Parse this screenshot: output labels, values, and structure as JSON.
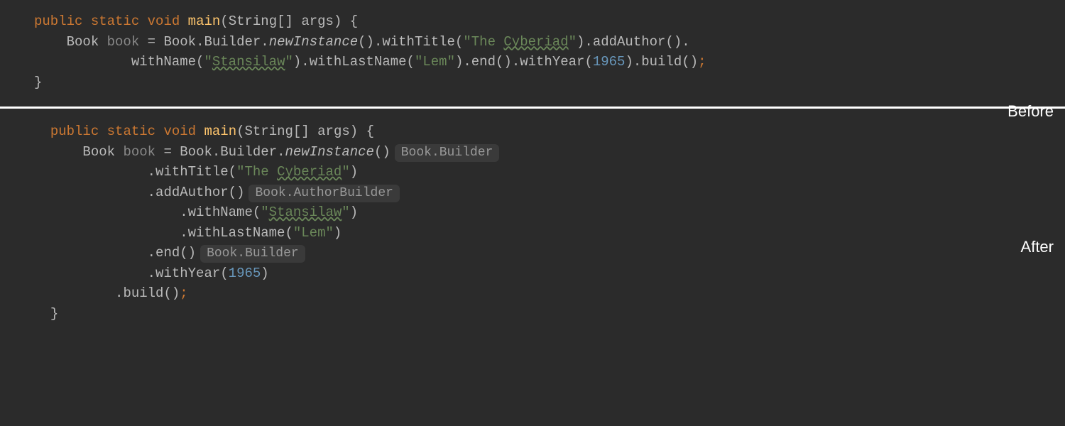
{
  "labels": {
    "before": "Before",
    "after": "After"
  },
  "keywords": {
    "public": "public",
    "static": "static",
    "void": "void"
  },
  "methodDef": "main",
  "paramType": "String",
  "brackets": "[]",
  "paramName": "args",
  "className": "Book",
  "varName": "book",
  "builderClass": "Builder",
  "methods": {
    "newInstance": "newInstance",
    "withTitle": "withTitle",
    "addAuthor": "addAuthor",
    "withName": "withName",
    "withLastName": "withLastName",
    "end": "end",
    "withYear": "withYear",
    "build": "build"
  },
  "strings": {
    "title": "The ",
    "titleTypo": "Cyberiad",
    "nameTypo": "Stansilaw",
    "lastName": "Lem"
  },
  "number": "1965",
  "hints": {
    "builder": "Book.Builder",
    "authorBuilder": "Book.AuthorBuilder",
    "builder2": "Book.Builder"
  },
  "punct": {
    "openParen": "(",
    "closeParen": ")",
    "openBrace": "{",
    "closeBrace": "}",
    "dot": ".",
    "quote": "\"",
    "semi": ";",
    "equals": " = ",
    "space": " "
  }
}
